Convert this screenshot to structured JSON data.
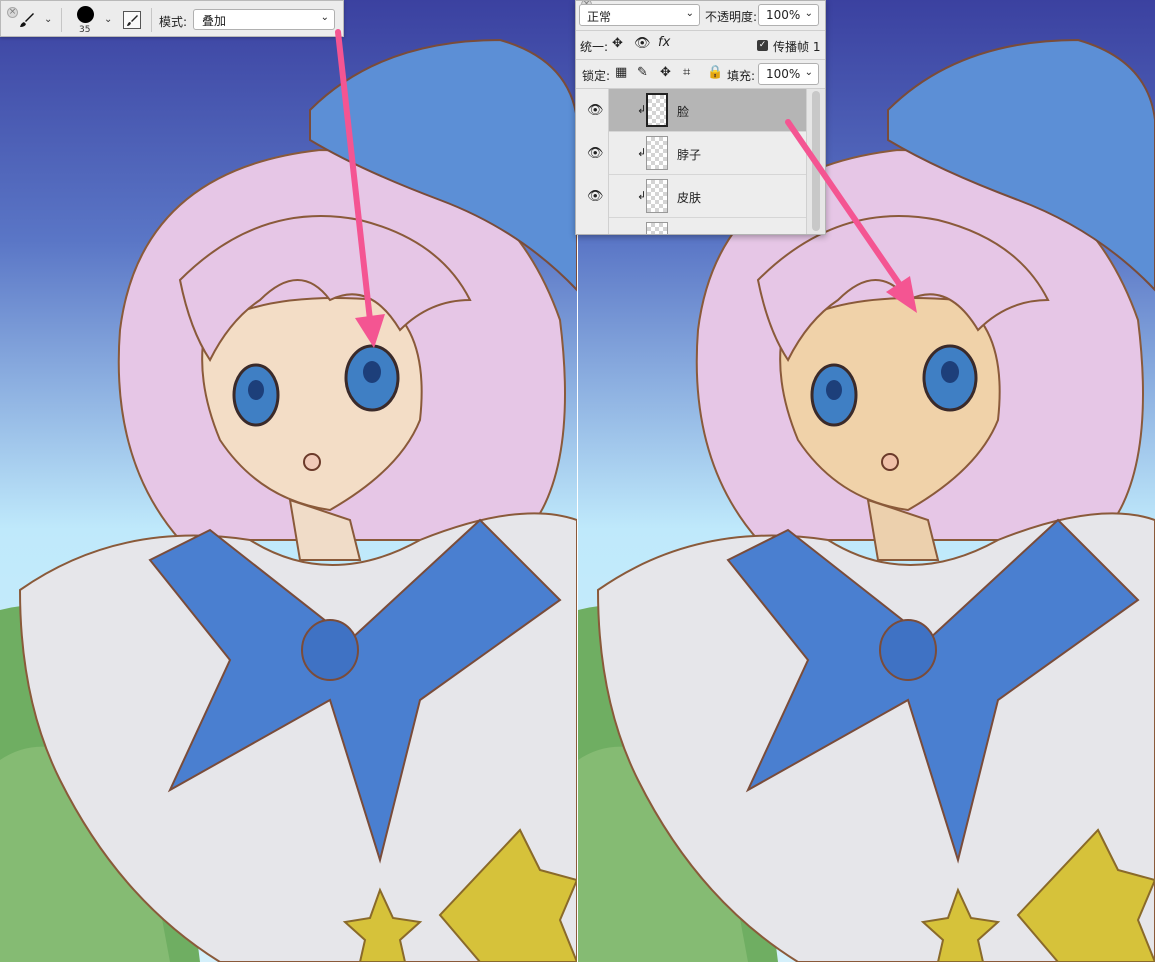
{
  "brush_bar": {
    "brush_size": "35",
    "mode_label": "模式:",
    "mode_value": "叠加",
    "icons": [
      "close-icon",
      "brush-icon",
      "chevron-down-icon",
      "brush-panel-icon"
    ]
  },
  "layers_panel": {
    "blend_mode": "正常",
    "opacity_label": "不透明度:",
    "opacity_value": "100%",
    "unify_label": "统一:",
    "propagate_label": "传播帧 1",
    "propagate_checked": true,
    "lock_label": "锁定:",
    "fill_label": "填充:",
    "fill_value": "100%",
    "layers": [
      {
        "name": "脸",
        "visible": true,
        "clipped": true,
        "selected": true
      },
      {
        "name": "脖子",
        "visible": true,
        "clipped": true,
        "selected": false
      },
      {
        "name": "皮肤",
        "visible": true,
        "clipped": true,
        "selected": false
      },
      {
        "name": "",
        "visible": false,
        "clipped": false,
        "selected": false
      }
    ]
  },
  "colors": {
    "annotation_arrow": "#f45592",
    "sky_top": "#3b41a0",
    "sky_bottom": "#bfe9fb",
    "hair": "#e6c6e6",
    "hat": "#5c8fd6",
    "skin_before": "#f3ddc6",
    "skin_after": "#f0d2a9",
    "ribbon": "#4a7fd0",
    "collar": "#e6e6ea",
    "grass": "#6fae62",
    "star": "#d6c23a"
  }
}
